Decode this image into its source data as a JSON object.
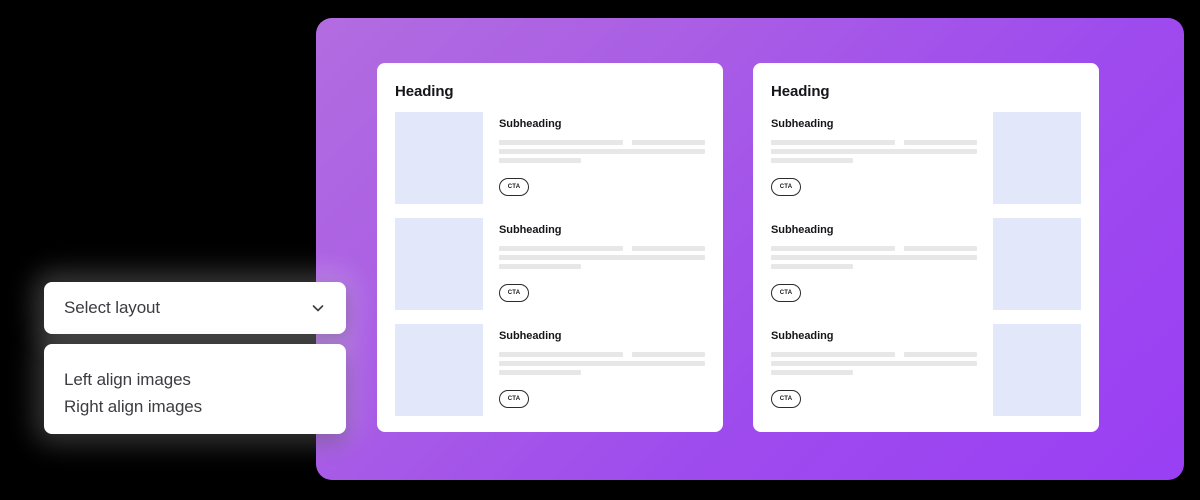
{
  "background": {
    "page_color": "#000000",
    "panel_gradient_from": "#B36CE0",
    "panel_gradient_to": "#9A3FF4"
  },
  "dropdown": {
    "name": "layout-selector",
    "selected_value": "Select layout",
    "chevron_icon": "chevron-down-icon",
    "options": [
      {
        "label": "Left align images"
      },
      {
        "label": "Right align images"
      }
    ]
  },
  "preview": {
    "cards": [
      {
        "layout": "left-align-images",
        "heading": "Heading",
        "rows": [
          {
            "subheading": "Subheading",
            "cta_label": "CTA"
          },
          {
            "subheading": "Subheading",
            "cta_label": "CTA"
          },
          {
            "subheading": "Subheading",
            "cta_label": "CTA"
          }
        ]
      },
      {
        "layout": "right-align-images",
        "heading": "Heading",
        "rows": [
          {
            "subheading": "Subheading",
            "cta_label": "CTA"
          },
          {
            "subheading": "Subheading",
            "cta_label": "CTA"
          },
          {
            "subheading": "Subheading",
            "cta_label": "CTA"
          }
        ]
      }
    ],
    "thumbnail_color": "#E3E7FA",
    "skeleton_color": "#E7E7E7",
    "card_background": "#FFFFFF"
  }
}
